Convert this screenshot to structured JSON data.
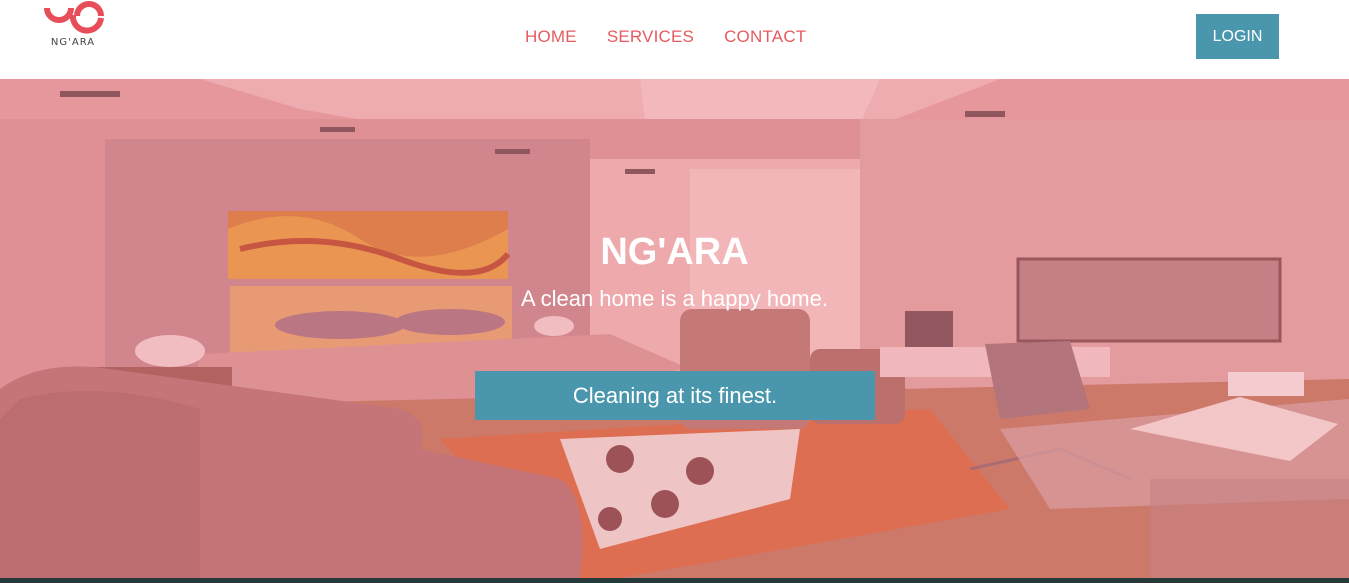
{
  "brand": {
    "name": "NG'ARA",
    "accent_color": "#e65b5f"
  },
  "nav": {
    "items": [
      {
        "label": "HOME"
      },
      {
        "label": "SERVICES"
      },
      {
        "label": "CONTACT"
      }
    ],
    "login_label": "LOGIN"
  },
  "hero": {
    "title": "NG'ARA",
    "tagline": "A clean home is a happy home.",
    "cta_label": "Cleaning at its finest.",
    "overlay_color": "#ec7882",
    "button_color": "#4a97ad"
  }
}
